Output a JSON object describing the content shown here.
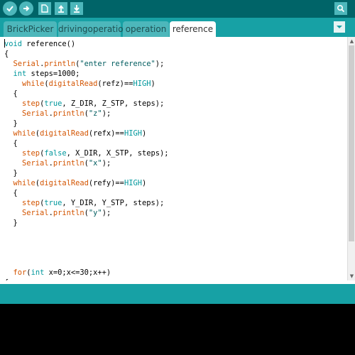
{
  "toolbar": {
    "buttons": [
      {
        "name": "verify-button",
        "icon": "checkmark-icon"
      },
      {
        "name": "upload-button",
        "icon": "arrow-right-icon"
      },
      {
        "name": "new-button",
        "icon": "new-file-icon"
      },
      {
        "name": "open-button",
        "icon": "arrow-up-icon"
      },
      {
        "name": "save-button",
        "icon": "arrow-down-icon"
      }
    ],
    "serial_monitor_icon": "magnifier-icon"
  },
  "tabs": [
    {
      "label": "BrickPicker",
      "active": false
    },
    {
      "label": "drivingoperation",
      "active": false
    },
    {
      "label": "operation",
      "active": false
    },
    {
      "label": "reference",
      "active": true
    }
  ],
  "tab_menu_icon": "chevron-down-icon",
  "code_lines": [
    [
      {
        "t": "void",
        "c": "k"
      },
      {
        "t": " reference()",
        "c": "n"
      }
    ],
    [
      {
        "t": "{",
        "c": "n"
      }
    ],
    [
      {
        "t": "  ",
        "c": "n"
      },
      {
        "t": "Serial",
        "c": "f"
      },
      {
        "t": ".",
        "c": "n"
      },
      {
        "t": "println",
        "c": "f"
      },
      {
        "t": "(",
        "c": "n"
      },
      {
        "t": "\"enter reference\"",
        "c": "s"
      },
      {
        "t": ");",
        "c": "n"
      }
    ],
    [
      {
        "t": "  ",
        "c": "n"
      },
      {
        "t": "int",
        "c": "k"
      },
      {
        "t": " steps=1000;",
        "c": "n"
      }
    ],
    [
      {
        "t": "    ",
        "c": "n"
      },
      {
        "t": "while",
        "c": "f"
      },
      {
        "t": "(",
        "c": "n"
      },
      {
        "t": "digitalRead",
        "c": "f"
      },
      {
        "t": "(refz)==",
        "c": "n"
      },
      {
        "t": "HIGH",
        "c": "k"
      },
      {
        "t": ")",
        "c": "n"
      }
    ],
    [
      {
        "t": "  {",
        "c": "n"
      }
    ],
    [
      {
        "t": "    ",
        "c": "n"
      },
      {
        "t": "step",
        "c": "f"
      },
      {
        "t": "(",
        "c": "n"
      },
      {
        "t": "true",
        "c": "k"
      },
      {
        "t": ", Z_DIR, Z_STP, steps);",
        "c": "n"
      }
    ],
    [
      {
        "t": "    ",
        "c": "n"
      },
      {
        "t": "Serial",
        "c": "f"
      },
      {
        "t": ".",
        "c": "n"
      },
      {
        "t": "println",
        "c": "f"
      },
      {
        "t": "(",
        "c": "n"
      },
      {
        "t": "\"z\"",
        "c": "s"
      },
      {
        "t": ");",
        "c": "n"
      }
    ],
    [
      {
        "t": "  }",
        "c": "n"
      }
    ],
    [
      {
        "t": "  ",
        "c": "n"
      },
      {
        "t": "while",
        "c": "f"
      },
      {
        "t": "(",
        "c": "n"
      },
      {
        "t": "digitalRead",
        "c": "f"
      },
      {
        "t": "(refx)==",
        "c": "n"
      },
      {
        "t": "HIGH",
        "c": "k"
      },
      {
        "t": ")",
        "c": "n"
      }
    ],
    [
      {
        "t": "  {",
        "c": "n"
      }
    ],
    [
      {
        "t": "    ",
        "c": "n"
      },
      {
        "t": "step",
        "c": "f"
      },
      {
        "t": "(",
        "c": "n"
      },
      {
        "t": "false",
        "c": "k"
      },
      {
        "t": ", X_DIR, X_STP, steps);",
        "c": "n"
      }
    ],
    [
      {
        "t": "    ",
        "c": "n"
      },
      {
        "t": "Serial",
        "c": "f"
      },
      {
        "t": ".",
        "c": "n"
      },
      {
        "t": "println",
        "c": "f"
      },
      {
        "t": "(",
        "c": "n"
      },
      {
        "t": "\"x\"",
        "c": "s"
      },
      {
        "t": ");",
        "c": "n"
      }
    ],
    [
      {
        "t": "  }",
        "c": "n"
      }
    ],
    [
      {
        "t": "  ",
        "c": "n"
      },
      {
        "t": "while",
        "c": "f"
      },
      {
        "t": "(",
        "c": "n"
      },
      {
        "t": "digitalRead",
        "c": "f"
      },
      {
        "t": "(refy)==",
        "c": "n"
      },
      {
        "t": "HIGH",
        "c": "k"
      },
      {
        "t": ")",
        "c": "n"
      }
    ],
    [
      {
        "t": "  {",
        "c": "n"
      }
    ],
    [
      {
        "t": "    ",
        "c": "n"
      },
      {
        "t": "step",
        "c": "f"
      },
      {
        "t": "(",
        "c": "n"
      },
      {
        "t": "true",
        "c": "k"
      },
      {
        "t": ", Y_DIR, Y_STP, steps);",
        "c": "n"
      }
    ],
    [
      {
        "t": "    ",
        "c": "n"
      },
      {
        "t": "Serial",
        "c": "f"
      },
      {
        "t": ".",
        "c": "n"
      },
      {
        "t": "println",
        "c": "f"
      },
      {
        "t": "(",
        "c": "n"
      },
      {
        "t": "\"y\"",
        "c": "s"
      },
      {
        "t": ");",
        "c": "n"
      }
    ],
    [
      {
        "t": "  }",
        "c": "n"
      }
    ],
    [],
    [],
    [],
    [],
    [
      {
        "t": "  ",
        "c": "n"
      },
      {
        "t": "for",
        "c": "f"
      },
      {
        "t": "(",
        "c": "n"
      },
      {
        "t": "int",
        "c": "k"
      },
      {
        "t": " x=0;x<=30;x++)",
        "c": "n"
      }
    ],
    [
      {
        "t": "{",
        "c": "n"
      }
    ]
  ],
  "colors": {
    "toolbar": "#006468",
    "tabbar": "#17a1a5",
    "tab": "#4db7bb",
    "active_tab": "#ffffff",
    "keyword": "#00979c",
    "function": "#d35400",
    "string": "#005c5f",
    "console": "#000000"
  }
}
